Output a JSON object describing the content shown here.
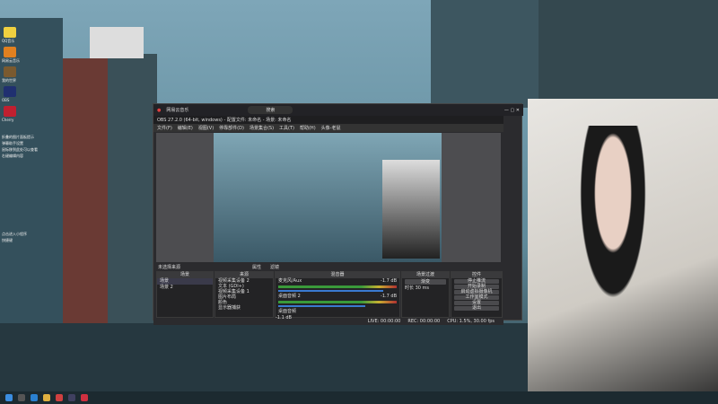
{
  "desktop": {
    "icons": [
      {
        "label": "QQ音乐",
        "color": "#f0d040"
      },
      {
        "label": "网易云音乐",
        "color": "#e08020"
      },
      {
        "label": "我的世界",
        "color": "#7a5a30"
      },
      {
        "label": "OBS",
        "color": "#203070"
      },
      {
        "label": "Cherry",
        "color": "#c02030"
      }
    ],
    "notes": [
      "折叠的图片面板提示",
      "弹幕助手设置",
      "鼠标移到此处可以查看",
      "右键编辑内容",
      "点击进入小程序",
      "快捷键"
    ]
  },
  "netease": {
    "title": "网易云音乐",
    "search_placeholder": "搜索"
  },
  "obs": {
    "title": "OBS 27.2.0 (64-bit, windows) - 配置文件: 未命名 - 场景: 未命名",
    "menu": [
      "文件(F)",
      "编辑(E)",
      "视图(V)",
      "停靠部件(D)",
      "场景集合(S)",
      "工具(T)",
      "帮助(H)",
      "头像-老鼠"
    ],
    "no_source": "未选择来源",
    "props": "属性",
    "filters": "滤镜",
    "scenes": {
      "header": "场景",
      "items": [
        "场景",
        "场景 2"
      ]
    },
    "sources": {
      "header": "来源",
      "items": [
        "视频采集设备 2",
        "文本 (GDI+)",
        "视频采集设备 1",
        "图片布局",
        "颜色",
        "显示器捕获"
      ]
    },
    "mixer": {
      "header": "混音器",
      "channels": [
        {
          "name": "麦克风/Aux",
          "db": "-1.7 dB",
          "level": 0.85
        },
        {
          "name": "桌面音频 2",
          "db": "-1.7 dB",
          "level": 0.7
        },
        {
          "name": "桌面音频",
          "db": "-1.1 dB",
          "level": 0.6
        }
      ]
    },
    "transitions": {
      "header": "场景过渡",
      "type": "渐变",
      "duration_label": "时长",
      "duration": "30 ms"
    },
    "controls": {
      "header": "控件",
      "buttons": [
        "停止推流",
        "开始录制",
        "启动虚拟摄像机",
        "工作室模式",
        "设置",
        "退出"
      ]
    },
    "status": {
      "live": "LIVE: 00:00:00",
      "rec": "REC: 00:00:00",
      "cpu": "CPU: 1.5%, 30.00 fps"
    }
  }
}
